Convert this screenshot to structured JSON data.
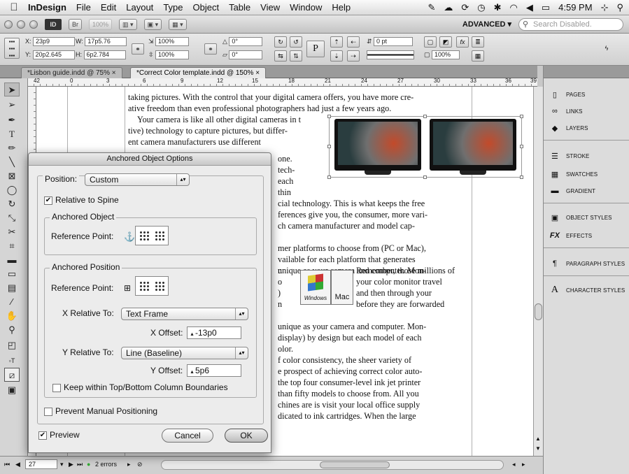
{
  "menubar": {
    "apple": "",
    "app": "InDesign",
    "items": [
      "File",
      "Edit",
      "Layout",
      "Type",
      "Object",
      "Table",
      "View",
      "Window",
      "Help"
    ],
    "clock": "4:59 PM"
  },
  "appbar": {
    "logo": "ID",
    "bridge": "Br",
    "zoom": "100%",
    "workspace": "ADVANCED ▾",
    "search_placeholder": "Search Disabled."
  },
  "control": {
    "x": "23p9",
    "y": "20p2.645",
    "w": "17p5.76",
    "h": "6p2.784",
    "scale_x": "100%",
    "scale_y": "100%",
    "rotate": "0°",
    "shear": "0°",
    "stroke": "0 pt",
    "opacity": "100%"
  },
  "tabs": [
    {
      "label": "*Lisbon guide.indd @ 75%",
      "close": "×"
    },
    {
      "label": "*Correct Color template.indd @ 150%",
      "close": "×"
    }
  ],
  "ruler": [
    "42",
    "0",
    "3",
    "6",
    "9",
    "12",
    "15",
    "18",
    "21",
    "24",
    "27",
    "30",
    "33",
    "36",
    "39"
  ],
  "body_text": [
    "taking pictures. With the control that your digital camera offers, you have more cre-",
    "ative freedom than even professional photographers had just a few years ago.",
    "Your camera is like all other digital cameras in t",
    "tive) technology to capture pictures, but differ-",
    "ent camera manufacturers use different",
    "one.",
    "tech-",
    "each",
    "thin",
    "cial technology. This is what keeps the free",
    "ferences give you, the consumer, more vari-",
    "ch camera manufacturer and model cap-",
    "mer platforms to choose from (PC or Mac),",
    "vailable for each platform that generates",
    "Remember, those millions of",
    "your color monitor travel",
    "and then through your",
    "before they are forwarded",
    "unique as your camera and computer. Mon-",
    "display) by design but each model of each",
    "olor.",
    "f color consistency, the sheer variety of",
    "e prospect of achieving correct color auto-",
    "the top four consumer-level ink jet printer",
    "than fifty models to choose from. All you",
    "chines are is visit your local office supply",
    "dicated to ink cartridges. When the large"
  ],
  "body_fragments": [
    "r.",
    "o",
    ")",
    "n"
  ],
  "os_labels": {
    "windows": "Windows",
    "mac": "Mac"
  },
  "panels": [
    {
      "label": "PAGES",
      "icon": "pages-icon"
    },
    {
      "label": "LINKS",
      "icon": "links-icon"
    },
    {
      "label": "LAYERS",
      "icon": "layers-icon"
    },
    {
      "label": "STROKE",
      "icon": "stroke-icon"
    },
    {
      "label": "SWATCHES",
      "icon": "swatches-icon"
    },
    {
      "label": "GRADIENT",
      "icon": "gradient-icon"
    },
    {
      "label": "OBJECT STYLES",
      "icon": "object-styles-icon"
    },
    {
      "label": "EFFECTS",
      "icon": "effects-icon"
    },
    {
      "label": "PARAGRAPH STYLES",
      "icon": "paragraph-styles-icon"
    },
    {
      "label": "CHARACTER STYLES",
      "icon": "character-styles-icon"
    }
  ],
  "dialog": {
    "title": "Anchored Object Options",
    "position_label": "Position:",
    "position_value": "Custom",
    "relative_to_spine": "Relative to Spine",
    "relative_to_spine_checked": true,
    "anchored_object_group": "Anchored Object",
    "reference_point_label": "Reference Point:",
    "anchored_position_group": "Anchored Position",
    "reference_point_label2": "Reference Point:",
    "x_relative_label": "X Relative To:",
    "x_relative_value": "Text Frame",
    "x_offset_label": "X Offset:",
    "x_offset_value": "-13p0",
    "y_relative_label": "Y Relative To:",
    "y_relative_value": "Line (Baseline)",
    "y_offset_label": "Y Offset:",
    "y_offset_value": "5p6",
    "keep_within": "Keep within Top/Bottom Column Boundaries",
    "keep_within_checked": false,
    "prevent_manual": "Prevent Manual Positioning",
    "prevent_manual_checked": false,
    "preview": "Preview",
    "preview_checked": true,
    "cancel": "Cancel",
    "ok": "OK"
  },
  "statusbar": {
    "page": "27",
    "errors": "2 errors"
  }
}
